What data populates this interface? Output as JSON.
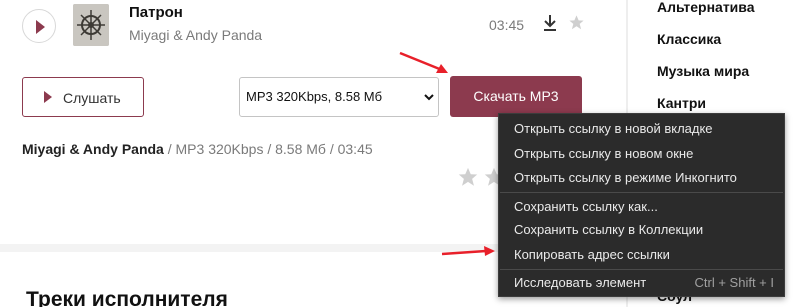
{
  "track": {
    "title": "Патрон",
    "artist": "Miyagi & Andy Panda",
    "duration": "03:45"
  },
  "controls": {
    "listen_label": "Слушать",
    "format_selected": "MP3 320Kbps, 8.58 Мб",
    "download_label": "Скачать MP3"
  },
  "meta": {
    "artist": "Miyagi & Andy Panda",
    "rest": " / MP3 320Kbps / 8.58 Мб / 03:45"
  },
  "section": {
    "title": "Треки исполнителя"
  },
  "genres": [
    "Альтернатива",
    "Классика",
    "Музыка мира",
    "Кантри",
    "Соул"
  ],
  "context_menu": {
    "items": [
      "Открыть ссылку в новой вкладке",
      "Открыть ссылку в новом окне",
      "Открыть ссылку в режиме Инкогнито",
      "Сохранить ссылку как...",
      "Сохранить ссылку в Коллекции",
      "Копировать адрес ссылки",
      "Исследовать элемент"
    ],
    "inspect_shortcut": "Ctrl + Shift + I"
  },
  "colors": {
    "accent": "#8c3a4e",
    "menu_bg": "#2b2b2b",
    "annotation_arrow": "#e8202a"
  }
}
